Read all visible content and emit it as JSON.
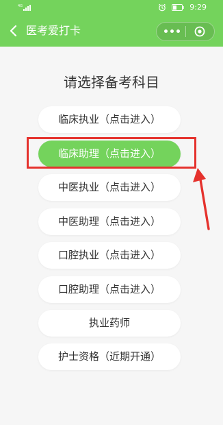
{
  "status_bar": {
    "signal_text": "4G",
    "time": "9:29"
  },
  "header": {
    "title": "医考爱打卡"
  },
  "main": {
    "prompt": "请选择备考科目",
    "options": [
      {
        "label": "临床执业（点击进入）",
        "selected": false
      },
      {
        "label": "临床助理（点击进入）",
        "selected": true
      },
      {
        "label": "中医执业（点击进入）",
        "selected": false
      },
      {
        "label": "中医助理（点击进入）",
        "selected": false
      },
      {
        "label": "口腔执业（点击进入）",
        "selected": false
      },
      {
        "label": "口腔助理（点击进入）",
        "selected": false
      },
      {
        "label": "执业药师",
        "selected": false
      },
      {
        "label": "护士资格（近期开通）",
        "selected": false
      }
    ]
  },
  "colors": {
    "brand_green": "#74d35c",
    "annotation_red": "#e5322d",
    "background": "#f6f6f6"
  },
  "icons": [
    "signal-icon",
    "alarm-clock-icon",
    "battery-icon",
    "back-chevron-icon",
    "more-dots-icon",
    "close-target-icon",
    "annotation-arrow"
  ]
}
